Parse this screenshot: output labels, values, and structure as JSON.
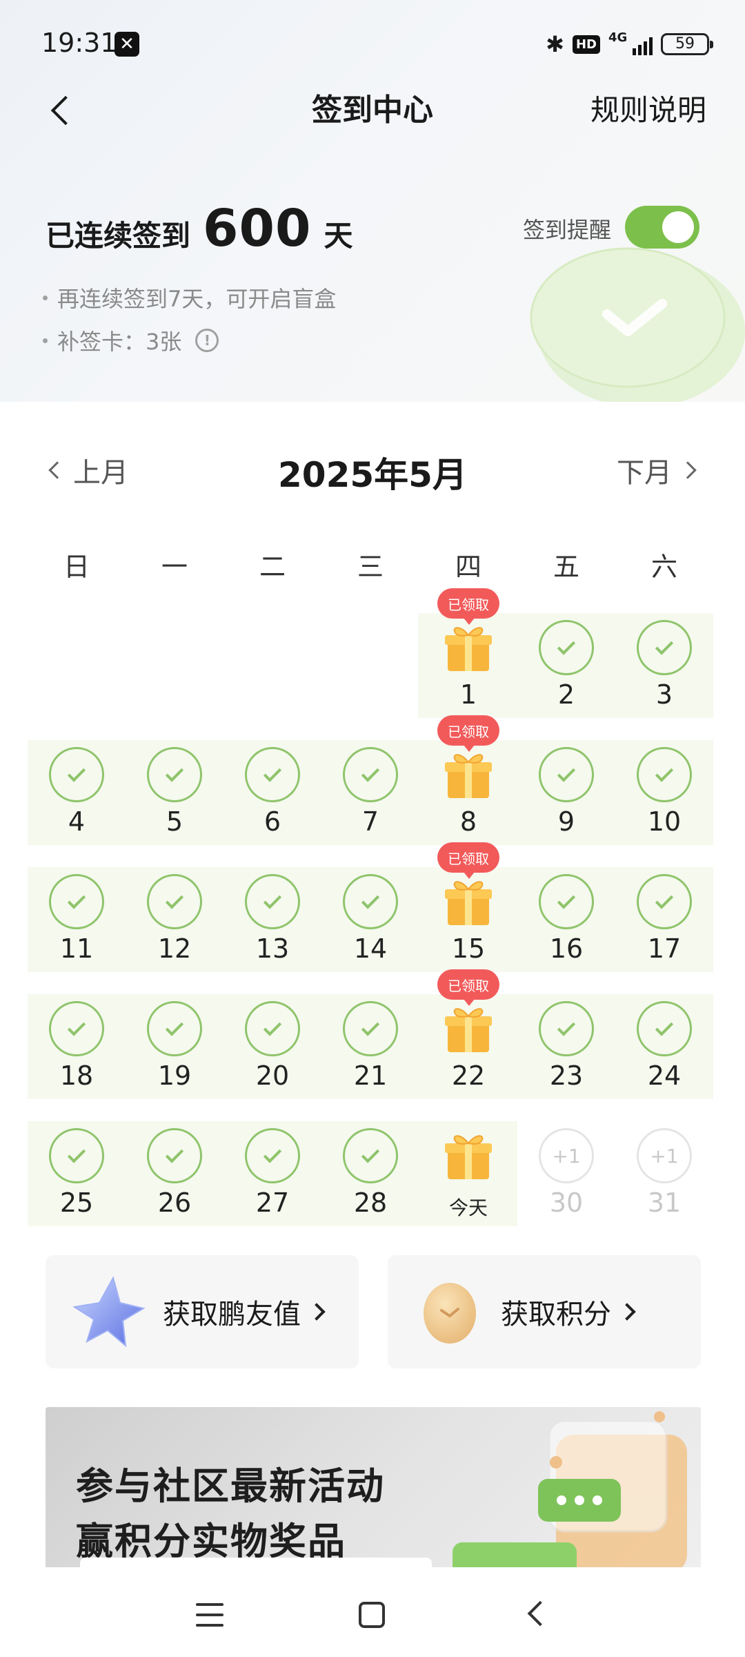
{
  "status": {
    "time": "19:31",
    "hd": "HD",
    "network": "4G",
    "battery": "59"
  },
  "header": {
    "title": "签到中心",
    "rules": "规则说明"
  },
  "summary": {
    "prefix": "已连续签到",
    "days": "600",
    "unit": "天",
    "reminder_label": "签到提醒",
    "reminder_on": true,
    "hint1": "再连续签到7天，可开启盲盒",
    "hint2": "补签卡：3张"
  },
  "calendar": {
    "title": "2025年5月",
    "prev": "上月",
    "next": "下月",
    "weekdays": [
      "日",
      "一",
      "二",
      "三",
      "四",
      "五",
      "六"
    ],
    "claimed_label": "已领取",
    "today_label": "今天",
    "bonus_label": "+1",
    "first_weekday": 4,
    "days_in_month": 31,
    "today": 29,
    "gift_days": [
      1,
      8,
      15,
      22,
      29
    ],
    "claimed_gift_days": [
      1,
      8,
      15,
      22
    ]
  },
  "cards": [
    {
      "label": "获取鹏友值",
      "icon": "star-icon"
    },
    {
      "label": "获取积分",
      "icon": "coin-icon"
    }
  ],
  "banner": {
    "line1": "参与社区最新活动",
    "line2": "赢积分实物奖品"
  },
  "colors": {
    "accent_green": "#7cc04b",
    "check_green": "#8fc46b",
    "badge_red": "#f25a5a",
    "row_bg": "#f5f9ee"
  }
}
